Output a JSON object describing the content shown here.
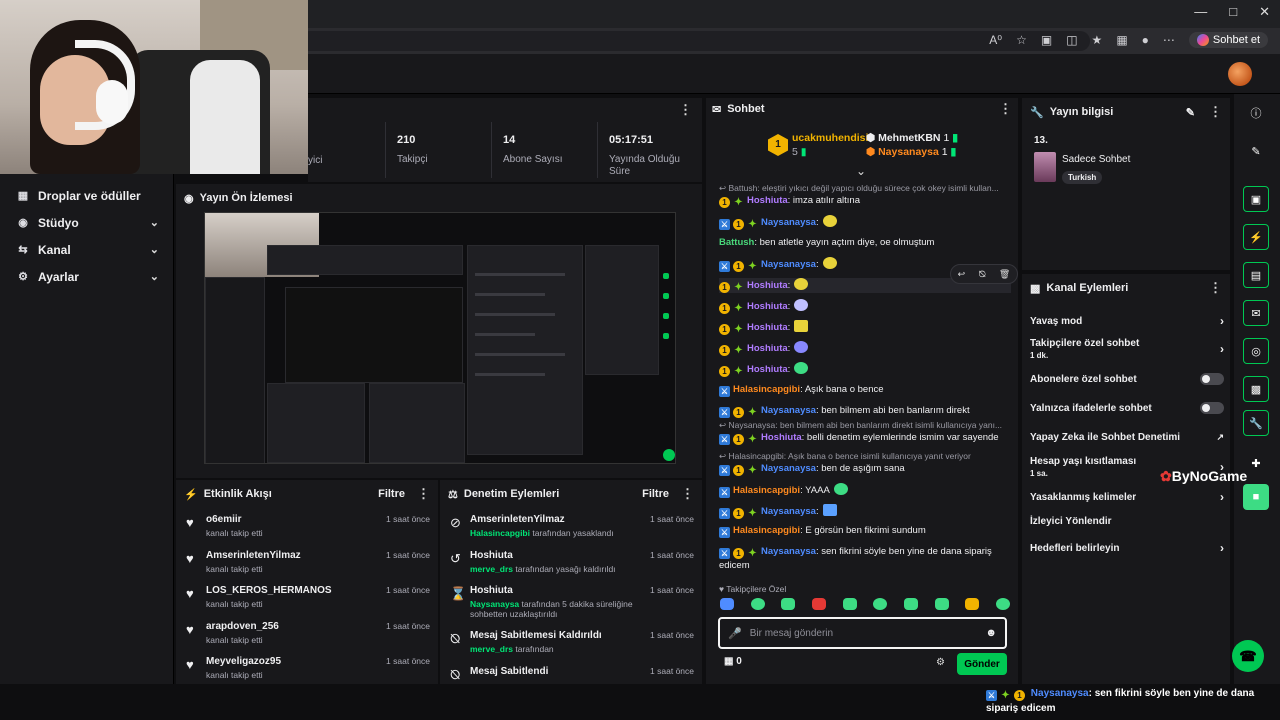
{
  "browser": {
    "copilot_label": "Sohbet et",
    "read_aloud": "A⁰"
  },
  "sidebar": {
    "items": [
      {
        "label": "Droplar ve ödüller",
        "icon": "gift-icon"
      },
      {
        "label": "Stüdyo",
        "icon": "studio-icon"
      },
      {
        "label": "Kanal",
        "icon": "channel-icon"
      },
      {
        "label": "Ayarlar",
        "icon": "gear-icon"
      }
    ]
  },
  "stats": [
    {
      "value": "",
      "caption": "yici"
    },
    {
      "value": "210",
      "caption": "Takipçi"
    },
    {
      "value": "14",
      "caption": "Abone Sayısı"
    },
    {
      "value": "05:17:51",
      "caption": "Yayında Olduğu Süre"
    }
  ],
  "preview": {
    "title": "Yayın Ön İzlemesi"
  },
  "activity": {
    "title": "Etkinlik Akışı",
    "filter": "Filtre",
    "items": [
      {
        "name": "o6emiir",
        "action": "kanalı takip etti",
        "time": "1 saat önce"
      },
      {
        "name": "AmserinletenYilmaz",
        "action": "kanalı takip etti",
        "time": "1 saat önce"
      },
      {
        "name": "LOS_KEROS_HERMANOS",
        "action": "kanalı takip etti",
        "time": "1 saat önce"
      },
      {
        "name": "arapdoven_256",
        "action": "kanalı takip etti",
        "time": "1 saat önce"
      },
      {
        "name": "Meyveligazoz95",
        "action": "kanalı takip etti",
        "time": "1 saat önce"
      }
    ]
  },
  "moderation": {
    "title": "Denetim Eylemleri",
    "filter": "Filtre",
    "items": [
      {
        "name": "AmserinletenYilmaz",
        "actor": "Halasincapgibi",
        "action": " tarafından yasaklandı",
        "time": "1 saat önce"
      },
      {
        "name": "Hoshiuta",
        "actor": "merve_drs",
        "action": " tarafından yasağı kaldırıldı",
        "time": "1 saat önce"
      },
      {
        "name": "Hoshiuta",
        "actor": "Naysanaysa",
        "action": " tarafından 5 dakika süreliğine sohbetten uzaklaştırıldı",
        "time": "1 saat önce"
      },
      {
        "name": "Mesaj Sabitlemesi Kaldırıldı",
        "actor": "merve_drs",
        "action": " tarafından",
        "time": "1 saat önce"
      },
      {
        "name": "Mesaj Sabitlendi",
        "actor": "",
        "action": "",
        "time": "1 saat önce"
      }
    ]
  },
  "chat": {
    "title": "Sohbet",
    "leaders": {
      "first": {
        "name": "ucakmuhendisi",
        "count": "5"
      },
      "second": {
        "name": "MehmetKBN",
        "count": "1"
      },
      "third": {
        "name": "Naysanaysa",
        "count": "1"
      }
    },
    "messages": [
      {
        "type": "sys",
        "text": "Battush: eleştiri yıkıcı değil yapıcı olduğu sürece çok okey isimli kullan..."
      },
      {
        "user": "Hoshiuta",
        "color": "purple",
        "text": ": imza atılır altına"
      },
      {
        "user": "Naysanaysa",
        "color": "blue",
        "text": ":",
        "emote": "#e8d23a"
      },
      {
        "user": "Battush",
        "color": "green",
        "text": ": ben atletle yayın açtım diye, oe olmuştum"
      },
      {
        "user": "Naysanaysa",
        "color": "blue",
        "text": ":",
        "emote": "#e8d23a"
      },
      {
        "user": "Hoshiuta",
        "color": "purple",
        "text": ":",
        "emote": "#e8d23a"
      },
      {
        "user": "Hoshiuta",
        "color": "purple",
        "text": ":",
        "emote": "#c0c0ff"
      },
      {
        "user": "Hoshiuta",
        "color": "purple",
        "text": ":",
        "emote": "#e8d23a"
      },
      {
        "user": "Hoshiuta",
        "color": "purple",
        "text": ":",
        "emote": "#8888ff"
      },
      {
        "user": "Hoshiuta",
        "color": "purple",
        "text": ":",
        "emote": "#3ddc84"
      },
      {
        "user": "Halasincapgibi",
        "color": "orange",
        "text": ": Aşık bana o bence"
      },
      {
        "user": "Naysanaysa",
        "color": "blue",
        "text": ": ben bilmem abi ben banlarım direkt"
      },
      {
        "type": "sys",
        "text": "Naysanaysa: ben bilmem abi ben banlarım direkt isimli kullanıcıya yanı..."
      },
      {
        "user": "Hoshiuta",
        "color": "purple",
        "text": ": belli denetim eylemlerinde ismim var sayende"
      },
      {
        "type": "sys",
        "text": "Halasincapgibi: Aşık bana o bence isimli kullanıcıya yanıt veriyor"
      },
      {
        "user": "Naysanaysa",
        "color": "blue",
        "text": ": ben de aşığım sana"
      },
      {
        "user": "Halasincapgibi",
        "color": "orange",
        "text": ": YAAA",
        "emote": "#3ddc84"
      },
      {
        "user": "Naysanaysa",
        "color": "blue",
        "text": ":",
        "emote": "#5aa0ff"
      },
      {
        "user": "Halasincapgibi",
        "color": "orange",
        "text": ": E görsün ben fikrimi sundum"
      },
      {
        "user": "Naysanaysa",
        "color": "blue",
        "text": ": sen fikrini söyle ben yine de dana sipariş edicem"
      }
    ],
    "followers_only": "Takipçilere Özel",
    "input_placeholder": "Bir mesaj gönderin",
    "points": "0",
    "send_label": "Gönder"
  },
  "stream_info": {
    "title": "Yayın bilgisi",
    "number": "13.",
    "stream_title": "Sadece Sohbet",
    "tag": "Turkish"
  },
  "channel_actions": {
    "title": "Kanal Eylemleri",
    "items": [
      {
        "label": "Yavaş mod",
        "control": "chevron"
      },
      {
        "label": "Takipçilere özel sohbet",
        "sub": "1 dk.",
        "control": "chevron"
      },
      {
        "label": "Abonelere özel sohbet",
        "control": "toggle"
      },
      {
        "label": "Yalnızca ifadelerle sohbet",
        "control": "toggle"
      },
      {
        "label": "Yapay Zeka ile Sohbet Denetimi",
        "control": "external"
      },
      {
        "label": "Hesap yaşı kısıtlaması",
        "sub": "1 sa.",
        "control": "chevron"
      },
      {
        "label": "Yasaklanmış kelimeler",
        "control": "chevron"
      },
      {
        "label": "İzleyici Yönlendir",
        "control": "none"
      },
      {
        "label": "Hedefleri belirleyin",
        "control": "chevron"
      }
    ]
  },
  "watermark": {
    "brand_a": "ByNo",
    "brand_b": "Game"
  },
  "overlay": {
    "user": "Naysanaysa",
    "text": ": sen fikrini söyle ben yine de dana sipariş edicem"
  },
  "colors": {
    "accent_green": "#00c853",
    "purple": "#b07cff",
    "orange": "#ff8a1f",
    "blue": "#4f8cff",
    "background": "#0e0e10",
    "panel": "#18181b"
  }
}
